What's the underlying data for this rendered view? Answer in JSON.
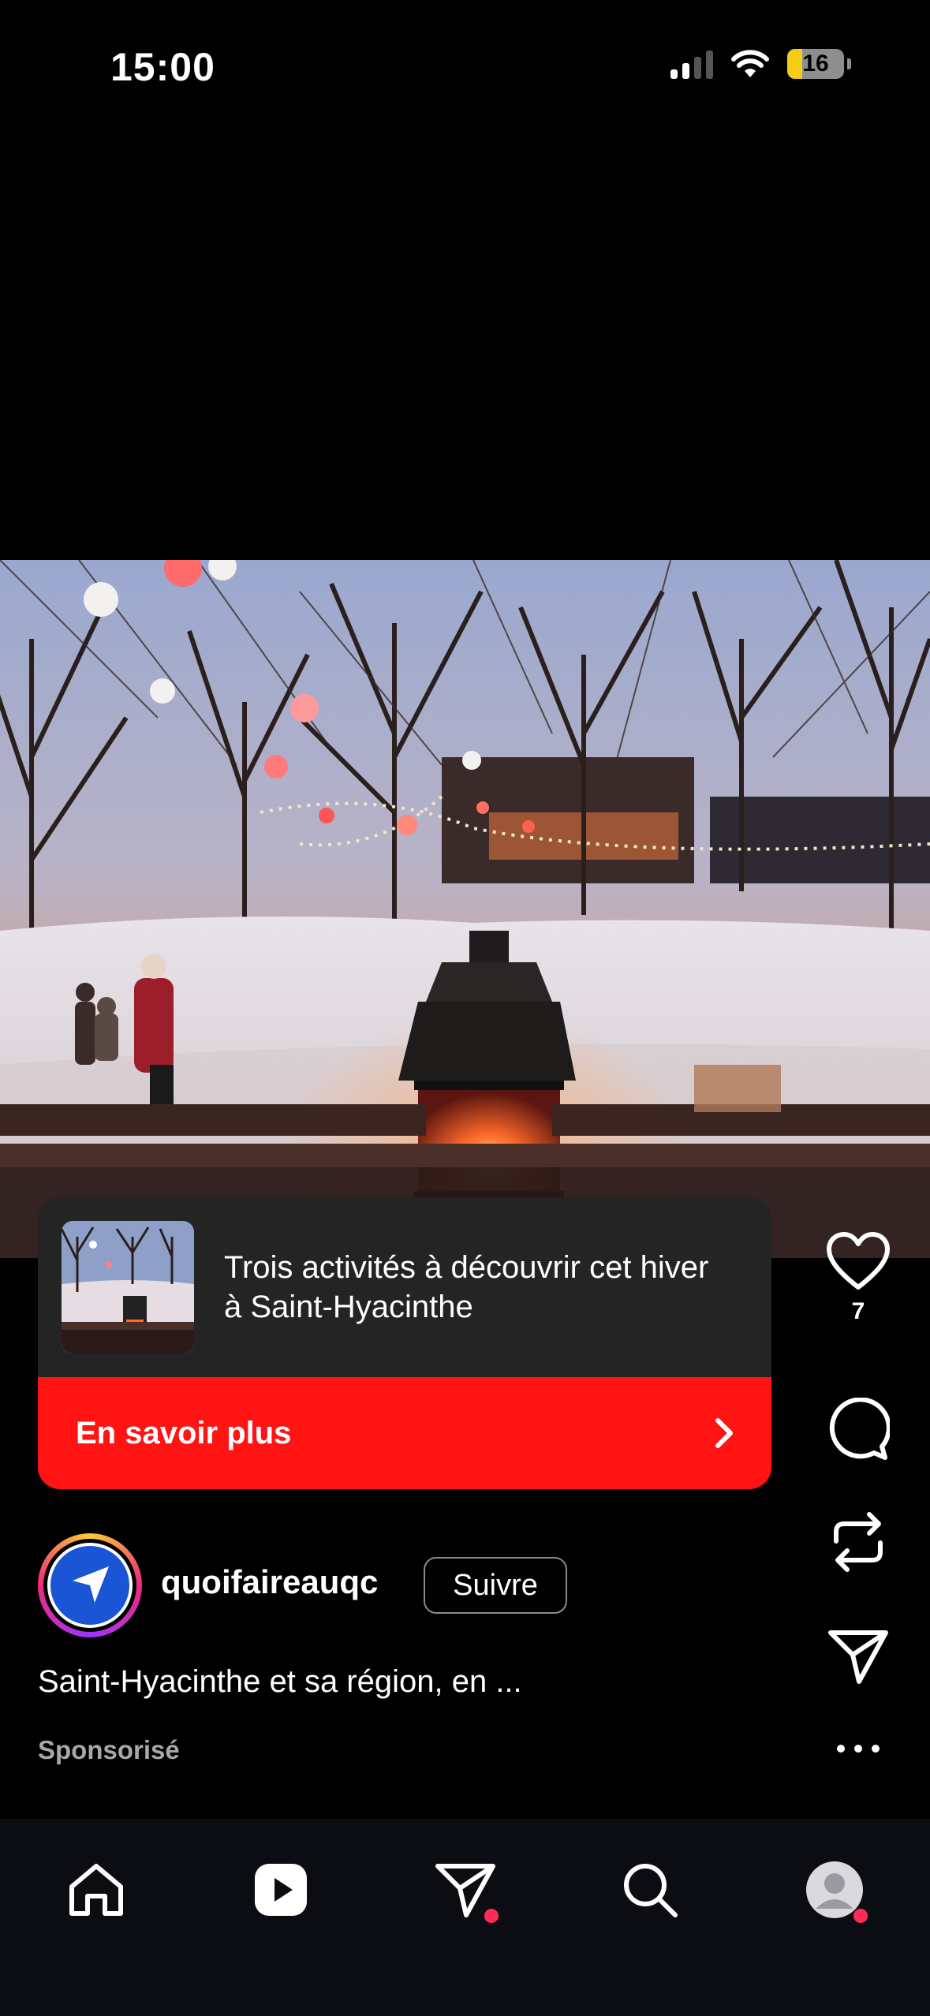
{
  "status_bar": {
    "time": "15:00",
    "battery": "16",
    "icons": [
      "signal-icon",
      "wifi-icon",
      "battery-icon"
    ]
  },
  "ad": {
    "title": "Trois activités à découvrir cet hiver à Saint-Hyacinthe",
    "cta_label": "En savoir plus",
    "cta_color": "#ff1313"
  },
  "actions": {
    "like_count": "7",
    "icons": [
      "heart-icon",
      "comment-icon",
      "repost-icon",
      "share-icon",
      "more-icon"
    ]
  },
  "author": {
    "username": "quoifaireauqc",
    "follow_label": "Suivre"
  },
  "caption": "Saint-Hyacinthe et sa région, en ...",
  "sponsored_label": "Sponsorisé",
  "nav": {
    "items": [
      "home-icon",
      "reels-icon",
      "messages-icon",
      "search-icon",
      "profile-icon"
    ],
    "badge_color": "#ff2d55"
  }
}
